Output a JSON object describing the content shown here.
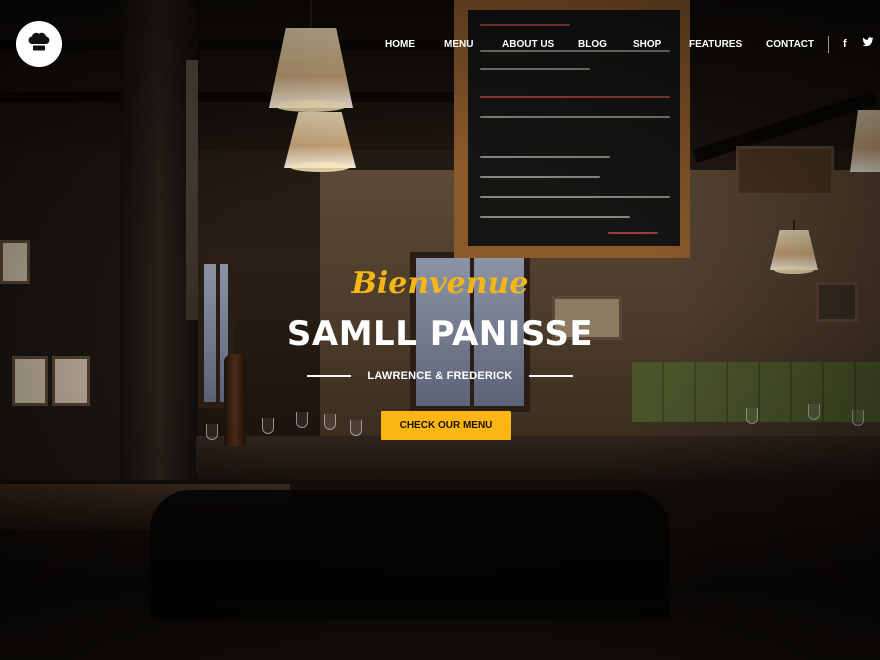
{
  "header": {
    "logo_icon": "chef-hat-icon",
    "nav": [
      {
        "label": "HOME"
      },
      {
        "label": "MENU"
      },
      {
        "label": "ABOUT US"
      },
      {
        "label": "BLOG"
      },
      {
        "label": "SHOP"
      },
      {
        "label": "FEATURES"
      },
      {
        "label": "CONTACT"
      }
    ],
    "social": [
      {
        "icon": "facebook-icon",
        "glyph": "f"
      },
      {
        "icon": "twitter-icon",
        "glyph": "🐦"
      }
    ]
  },
  "hero": {
    "script_heading": "Bienvenue",
    "title": "SAMLL PANISSE",
    "subtitle": "LAWRENCE & FREDERICK",
    "cta_label": "CHECK OUR MENU"
  },
  "colors": {
    "accent": "#fcb614",
    "script": "#f5b617",
    "text": "#ffffff"
  }
}
